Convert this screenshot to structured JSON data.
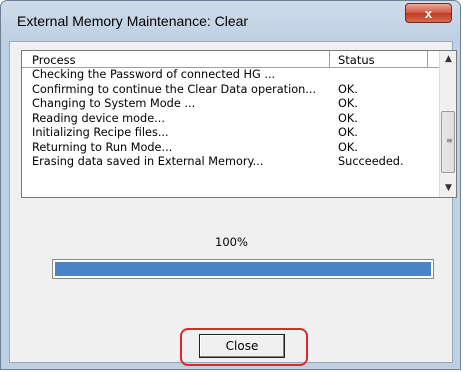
{
  "window": {
    "title": "External Memory Maintenance: Clear",
    "close_glyph": "x"
  },
  "list": {
    "headers": {
      "process": "Process",
      "status": "Status"
    },
    "rows": [
      {
        "process": "Checking the Password of connected HG ...",
        "status": ""
      },
      {
        "process": "Confirming to continue the Clear Data operation...",
        "status": "OK."
      },
      {
        "process": "Changing to System Mode ...",
        "status": "OK."
      },
      {
        "process": "Reading device mode...",
        "status": "OK."
      },
      {
        "process": "Initializing Recipe files...",
        "status": "OK."
      },
      {
        "process": "Returning to Run Mode...",
        "status": "OK."
      },
      {
        "process": "Erasing data saved in External Memory...",
        "status": "Succeeded."
      }
    ]
  },
  "progress": {
    "label": "100%",
    "value_percent": 100
  },
  "buttons": {
    "close_label": "Close"
  },
  "colors": {
    "progress_fill": "#4a84c8",
    "highlight": "#e0282a"
  }
}
